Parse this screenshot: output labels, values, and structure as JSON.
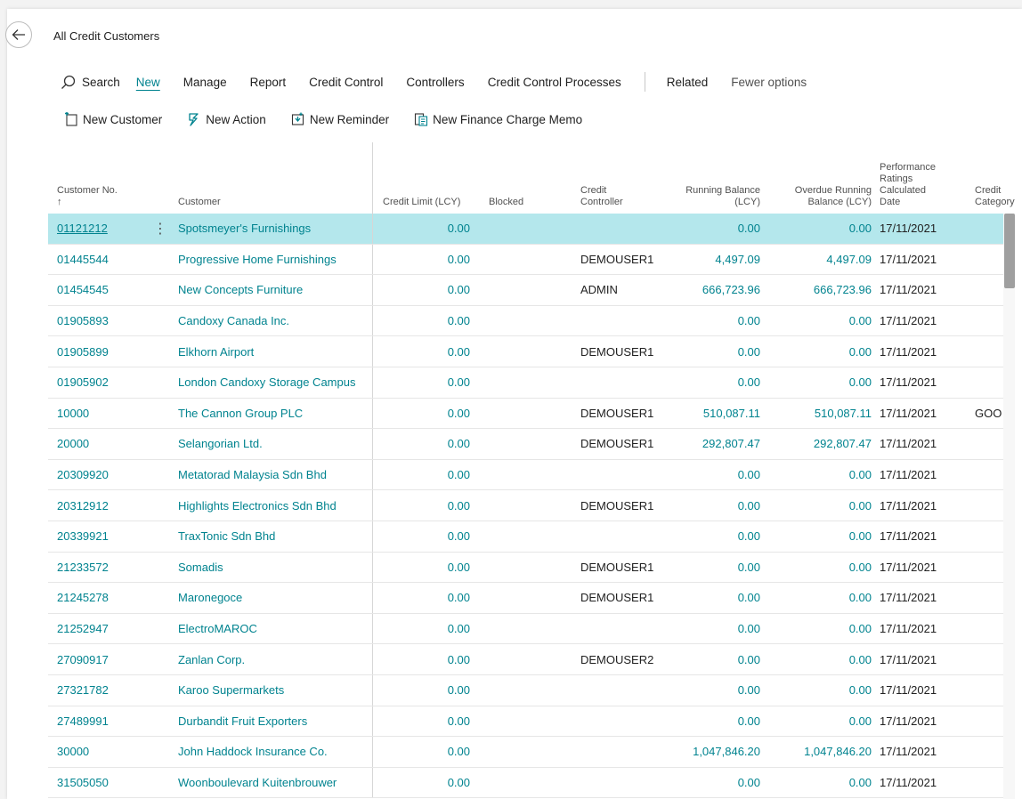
{
  "page": {
    "title": "All Credit Customers"
  },
  "actions": {
    "search": "Search",
    "items": [
      "New",
      "Manage",
      "Report",
      "Credit Control",
      "Controllers",
      "Credit Control Processes"
    ],
    "related": "Related",
    "fewer": "Fewer options"
  },
  "promoted": [
    "New Customer",
    "New Action",
    "New Reminder",
    "New Finance Charge Memo"
  ],
  "columns": {
    "customer_no": "Customer No.",
    "sort_arrow": "↑",
    "customer": "Customer",
    "credit_limit": "Credit Limit (LCY)",
    "blocked": "Blocked",
    "credit_controller_1": "Credit",
    "credit_controller_2": "Controller",
    "running_balance_1": "Running Balance",
    "running_balance_2": "(LCY)",
    "overdue_1": "Overdue Running",
    "overdue_2": "Balance (LCY)",
    "perf_1": "Performance",
    "perf_2": "Ratings",
    "perf_3": "Calculated",
    "perf_4": "Date",
    "category_1": "Credit",
    "category_2": "Category"
  },
  "rows": [
    {
      "no": "01121212",
      "name": "Spotsmeyer's Furnishings",
      "limit": "0.00",
      "controller": "",
      "running": "0.00",
      "overdue": "0.00",
      "date": "17/11/2021",
      "category": ""
    },
    {
      "no": "01445544",
      "name": "Progressive Home Furnishings",
      "limit": "0.00",
      "controller": "DEMOUSER1",
      "running": "4,497.09",
      "overdue": "4,497.09",
      "date": "17/11/2021",
      "category": ""
    },
    {
      "no": "01454545",
      "name": "New Concepts Furniture",
      "limit": "0.00",
      "controller": "ADMIN",
      "running": "666,723.96",
      "overdue": "666,723.96",
      "date": "17/11/2021",
      "category": ""
    },
    {
      "no": "01905893",
      "name": "Candoxy Canada Inc.",
      "limit": "0.00",
      "controller": "",
      "running": "0.00",
      "overdue": "0.00",
      "date": "17/11/2021",
      "category": ""
    },
    {
      "no": "01905899",
      "name": "Elkhorn Airport",
      "limit": "0.00",
      "controller": "DEMOUSER1",
      "running": "0.00",
      "overdue": "0.00",
      "date": "17/11/2021",
      "category": ""
    },
    {
      "no": "01905902",
      "name": "London Candoxy Storage Campus",
      "limit": "0.00",
      "controller": "",
      "running": "0.00",
      "overdue": "0.00",
      "date": "17/11/2021",
      "category": ""
    },
    {
      "no": "10000",
      "name": "The Cannon Group PLC",
      "limit": "0.00",
      "controller": "DEMOUSER1",
      "running": "510,087.11",
      "overdue": "510,087.11",
      "date": "17/11/2021",
      "category": "GOO"
    },
    {
      "no": "20000",
      "name": "Selangorian Ltd.",
      "limit": "0.00",
      "controller": "DEMOUSER1",
      "running": "292,807.47",
      "overdue": "292,807.47",
      "date": "17/11/2021",
      "category": ""
    },
    {
      "no": "20309920",
      "name": "Metatorad Malaysia Sdn Bhd",
      "limit": "0.00",
      "controller": "",
      "running": "0.00",
      "overdue": "0.00",
      "date": "17/11/2021",
      "category": ""
    },
    {
      "no": "20312912",
      "name": "Highlights Electronics Sdn Bhd",
      "limit": "0.00",
      "controller": "DEMOUSER1",
      "running": "0.00",
      "overdue": "0.00",
      "date": "17/11/2021",
      "category": ""
    },
    {
      "no": "20339921",
      "name": "TraxTonic Sdn Bhd",
      "limit": "0.00",
      "controller": "",
      "running": "0.00",
      "overdue": "0.00",
      "date": "17/11/2021",
      "category": ""
    },
    {
      "no": "21233572",
      "name": "Somadis",
      "limit": "0.00",
      "controller": "DEMOUSER1",
      "running": "0.00",
      "overdue": "0.00",
      "date": "17/11/2021",
      "category": ""
    },
    {
      "no": "21245278",
      "name": "Maronegoce",
      "limit": "0.00",
      "controller": "DEMOUSER1",
      "running": "0.00",
      "overdue": "0.00",
      "date": "17/11/2021",
      "category": ""
    },
    {
      "no": "21252947",
      "name": "ElectroMAROC",
      "limit": "0.00",
      "controller": "",
      "running": "0.00",
      "overdue": "0.00",
      "date": "17/11/2021",
      "category": ""
    },
    {
      "no": "27090917",
      "name": "Zanlan Corp.",
      "limit": "0.00",
      "controller": "DEMOUSER2",
      "running": "0.00",
      "overdue": "0.00",
      "date": "17/11/2021",
      "category": ""
    },
    {
      "no": "27321782",
      "name": "Karoo Supermarkets",
      "limit": "0.00",
      "controller": "",
      "running": "0.00",
      "overdue": "0.00",
      "date": "17/11/2021",
      "category": ""
    },
    {
      "no": "27489991",
      "name": "Durbandit Fruit Exporters",
      "limit": "0.00",
      "controller": "",
      "running": "0.00",
      "overdue": "0.00",
      "date": "17/11/2021",
      "category": ""
    },
    {
      "no": "30000",
      "name": "John Haddock Insurance Co.",
      "limit": "0.00",
      "controller": "",
      "running": "1,047,846.20",
      "overdue": "1,047,846.20",
      "date": "17/11/2021",
      "category": ""
    },
    {
      "no": "31505050",
      "name": "Woonboulevard Kuitenbrouwer",
      "limit": "0.00",
      "controller": "",
      "running": "0.00",
      "overdue": "0.00",
      "date": "17/11/2021",
      "category": ""
    }
  ],
  "colors": {
    "accent": "#00838f",
    "selected_row": "#b4e7ec"
  }
}
